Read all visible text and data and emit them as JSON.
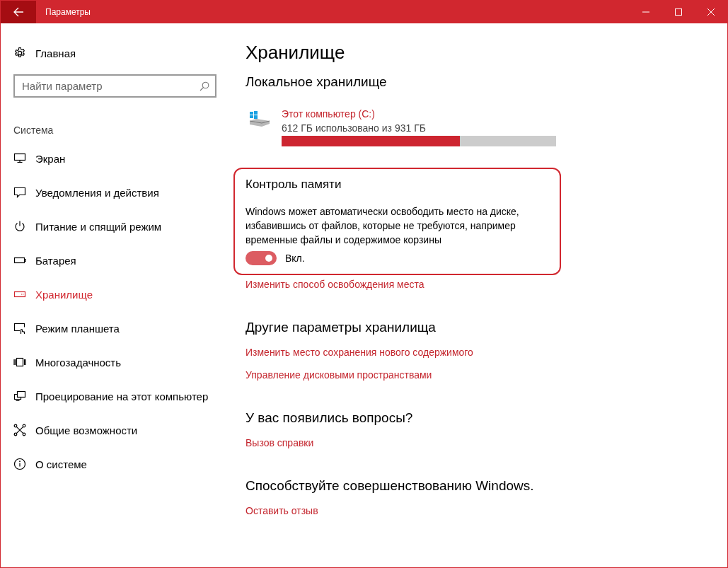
{
  "window": {
    "title": "Параметры"
  },
  "sidebar": {
    "home": "Главная",
    "search": {
      "placeholder": "Найти параметр"
    },
    "section": "Система",
    "items": [
      {
        "label": "Экран",
        "selected": false
      },
      {
        "label": "Уведомления и действия",
        "selected": false
      },
      {
        "label": "Питание и спящий режим",
        "selected": false
      },
      {
        "label": "Батарея",
        "selected": false
      },
      {
        "label": "Хранилище",
        "selected": true
      },
      {
        "label": "Режим планшета",
        "selected": false
      },
      {
        "label": "Многозадачность",
        "selected": false
      },
      {
        "label": "Проецирование на этот компьютер",
        "selected": false
      },
      {
        "label": "Общие возможности",
        "selected": false
      },
      {
        "label": "О системе",
        "selected": false
      }
    ]
  },
  "page": {
    "title": "Хранилище",
    "local": {
      "heading": "Локальное хранилище",
      "drives": [
        {
          "name": "Этот компьютер (C:)",
          "usage": "612 ГБ использовано из 931 ГБ",
          "level": 0.65
        }
      ]
    },
    "storage_sense": {
      "heading": "Контроль памяти",
      "description": "Windows может автоматически освободить место на диске, избавившись от файлов, которые не требуются, например временные файлы и содержимое корзины",
      "toggle": {
        "on": true,
        "label": "Вкл."
      },
      "link": "Изменить способ освобождения места"
    },
    "sections": [
      {
        "heading": "Другие параметры хранилища",
        "links": [
          "Изменить место сохранения нового содержимого",
          "Управление дисковыми пространствами"
        ]
      },
      {
        "heading": "У вас появились вопросы?",
        "links": [
          "Вызов справки"
        ]
      },
      {
        "heading": "Способствуйте совершенствованию Windows.",
        "links": [
          "Оставить отзыв"
        ]
      }
    ]
  }
}
